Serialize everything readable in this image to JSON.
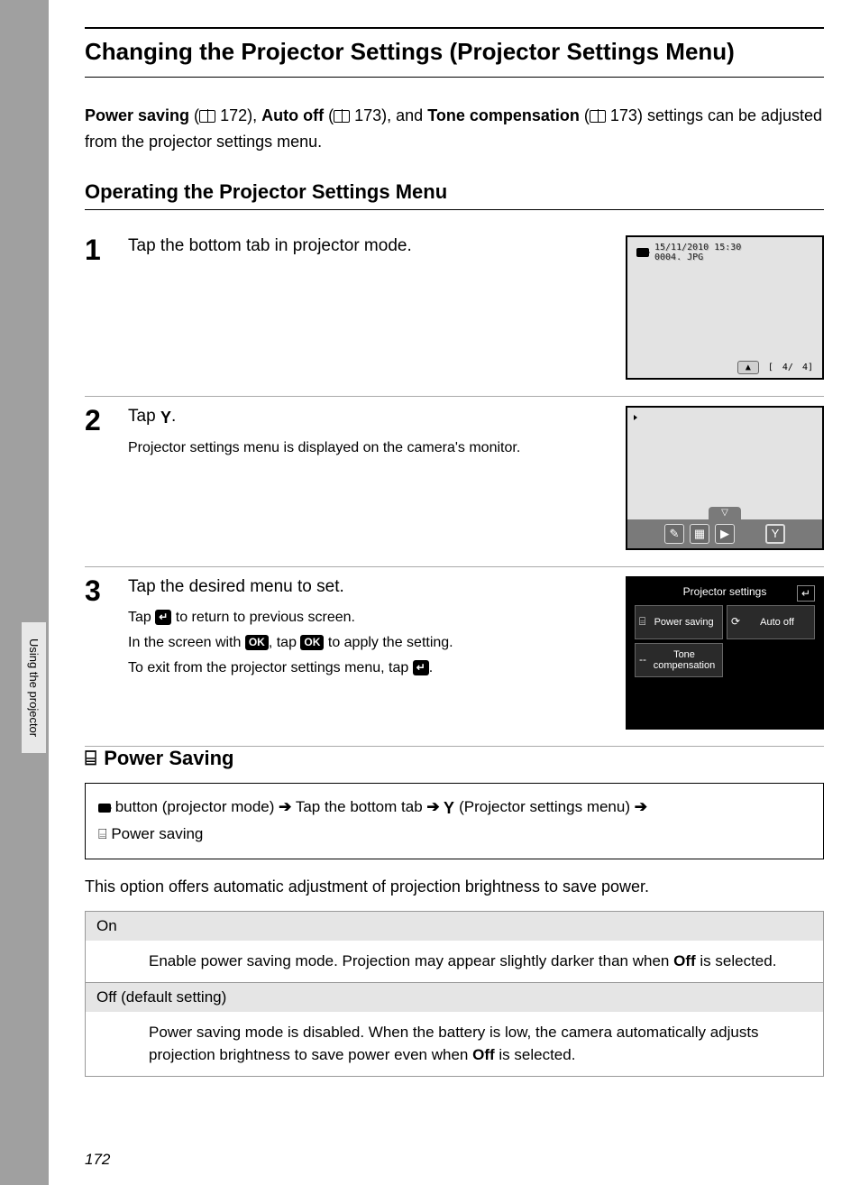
{
  "sideTab": "Using the projector",
  "pageNumber": "172",
  "mainTitle": "Changing the Projector Settings (Projector Settings Menu)",
  "intro": {
    "b1": "Power saving",
    "ref1": "172",
    "b2": "Auto off",
    "ref2": "173",
    "mid": ", and ",
    "b3": "Tone compensation",
    "ref3": "173",
    "tail": "settings can be adjusted from the projector settings menu."
  },
  "subhead": "Operating the Projector Settings Menu",
  "steps": {
    "s1": {
      "num": "1",
      "title": "Tap the bottom tab in projector mode."
    },
    "s2": {
      "num": "2",
      "title_pre": "Tap ",
      "title_post": ".",
      "detail": "Projector settings menu is displayed on the camera's monitor."
    },
    "s3": {
      "num": "3",
      "title": "Tap the desired menu to set.",
      "d1_pre": "Tap ",
      "d1_post": " to return to previous screen.",
      "d2_pre": "In the screen with ",
      "d2_mid": ", tap ",
      "d2_post": " to apply the setting.",
      "d3_pre": "To exit from the projector settings menu, tap ",
      "d3_post": "."
    }
  },
  "screen1": {
    "dateline": "15/11/2010 15:30",
    "fileline": "0004. JPG",
    "counter_a": "4/",
    "counter_b": "4]",
    "bracket": "["
  },
  "screen3": {
    "title": "Projector settings",
    "opt1": "Power saving",
    "opt2": "Auto off",
    "opt3": "Tone compensation",
    "opt3_prefix": "--"
  },
  "ps": {
    "heading": "Power Saving",
    "bc1": " button (projector mode) ",
    "bc2": " Tap the bottom tab ",
    "bc3": " (Projector settings menu) ",
    "bc4": " Power saving",
    "desc": "This option offers automatic adjustment of projection brightness to save power.",
    "on_label": "On",
    "on_body_pre": "Enable power saving mode. Projection may appear slightly darker than when ",
    "on_body_bold": "Off",
    "on_body_post": " is selected.",
    "off_label": "Off (default setting)",
    "off_body_pre": "Power saving mode is disabled. When the battery is low, the camera automatically adjusts projection brightness to save power even when ",
    "off_body_bold": "Off",
    "off_body_post": " is selected."
  },
  "icons": {
    "ok": "OK",
    "back": "↵",
    "wrench": "Y",
    "arrow": "➔",
    "up": "▲",
    "down": "▽",
    "pencil": "✎",
    "grid": "▦",
    "play": "▶",
    "stack": "⌸"
  }
}
